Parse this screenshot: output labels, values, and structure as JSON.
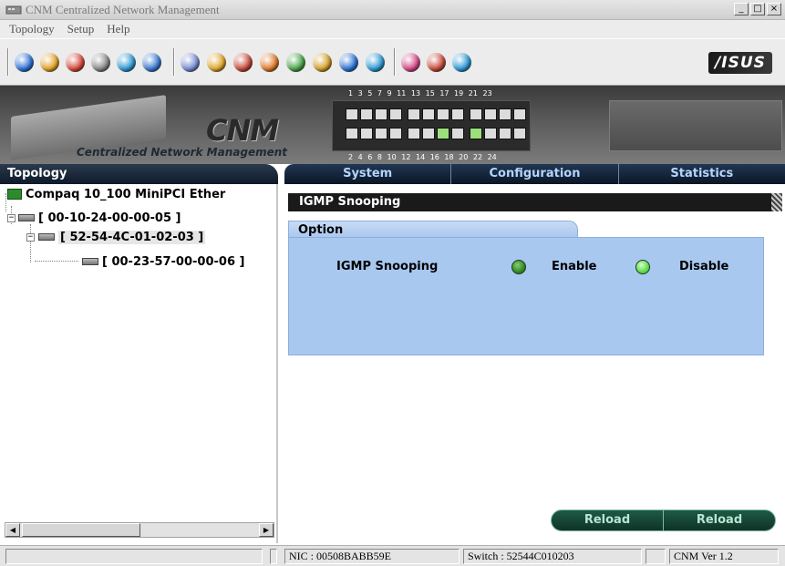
{
  "window": {
    "title": "CNM  Centralized Network Management",
    "controls": [
      "_",
      "□",
      "×"
    ]
  },
  "menu": {
    "items": [
      "Topology",
      "Setup",
      "Help"
    ]
  },
  "toolbar": {
    "group1": [
      "#2f74d6",
      "#e6a22a",
      "#d84b3d",
      "#8a8a8a",
      "#2f9ad6",
      "#3d7bd1"
    ],
    "group2": [
      "#7a8fd6",
      "#e0a72b",
      "#c94b3c",
      "#e07a2b",
      "#4aa34a",
      "#d6a12b",
      "#2f74d6",
      "#2f9ad6"
    ],
    "group3": [
      "#d64a8a",
      "#c94b3c",
      "#2f9ad6"
    ],
    "brand": "/ISUS"
  },
  "banner": {
    "logo": "CNM",
    "tagline": "Centralized Network Management",
    "ports_top": "1  3  5  7   9  11 13 15  17 19 21 23",
    "ports_bottom": "2  4  6  8  10 12 14 16  18 20 22 24",
    "active_ports_top": [],
    "active_ports_bottom": [
      7,
      9
    ]
  },
  "topology": {
    "header": "Topology",
    "root": "Compaq 10_100 MiniPCI Ether",
    "nodes": [
      "[ 00-10-24-00-00-05 ]",
      "[ 52-54-4C-01-02-03 ]",
      "[ 00-23-57-00-00-06 ]"
    ]
  },
  "tabs": [
    "System",
    "Configuration",
    "Statistics"
  ],
  "content": {
    "section_title": "IGMP Snooping",
    "option_title": "Option",
    "igmp_label": "IGMP Snooping",
    "enable_label": "Enable",
    "disable_label": "Disable",
    "selected": "Disable"
  },
  "buttons": {
    "reload_1": "Reload",
    "reload_2": "Reload"
  },
  "status": {
    "nic": "NIC : 00508BABB59E",
    "switch": "Switch : 52544C010203",
    "version": "CNM Ver 1.2"
  }
}
